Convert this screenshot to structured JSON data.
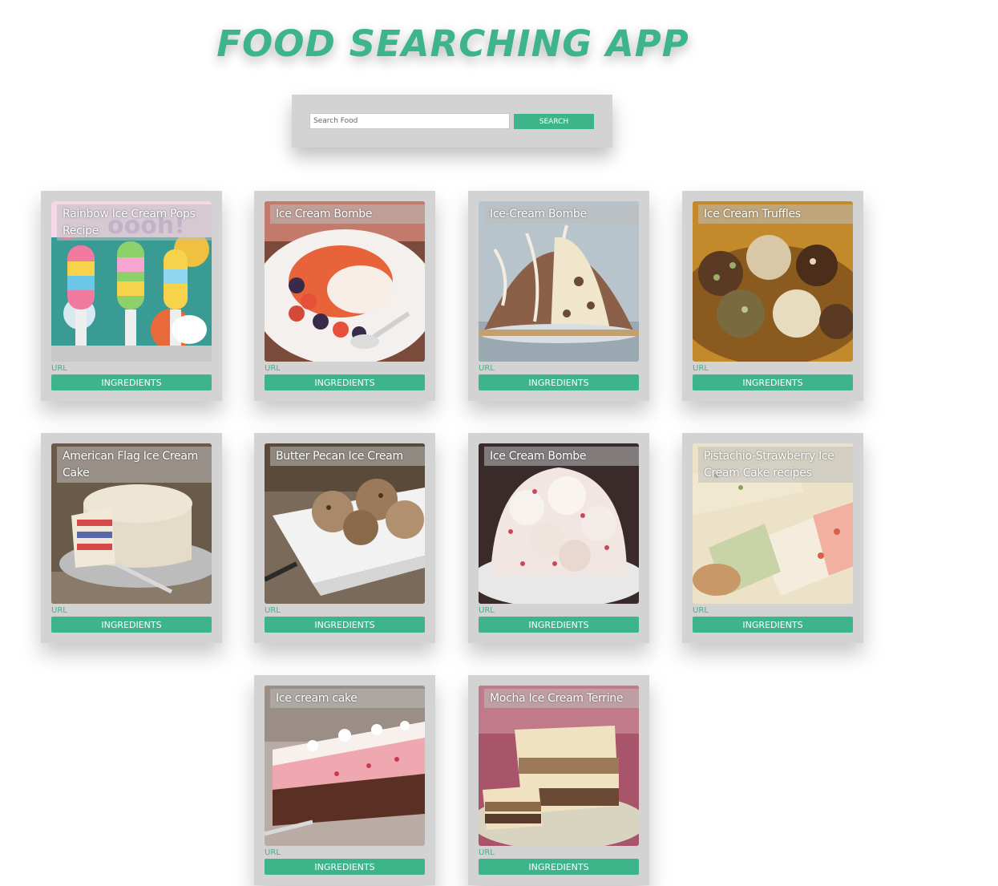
{
  "app": {
    "title": "FOOD SEARCHING APP",
    "accent_color": "#3db489"
  },
  "search": {
    "placeholder": "Search Food",
    "value": "",
    "button_label": "SEARCH"
  },
  "recipes": [
    {
      "title": "Rainbow Ice Cream Pops Recipe",
      "url_label": "URL",
      "button_label": "INGREDIENTS",
      "image": "rainbow-ice-cream-pops-photo"
    },
    {
      "title": "Ice Cream Bombe",
      "url_label": "URL",
      "button_label": "INGREDIENTS",
      "image": "ice-cream-bombe-with-berries-photo"
    },
    {
      "title": "Ice-Cream Bombe",
      "url_label": "URL",
      "button_label": "INGREDIENTS",
      "image": "chocolate-drizzled-dome-photo"
    },
    {
      "title": "Ice Cream Truffles",
      "url_label": "URL",
      "button_label": "INGREDIENTS",
      "image": "nut-coated-truffles-photo"
    },
    {
      "title": "American Flag Ice Cream Cake",
      "url_label": "URL",
      "button_label": "INGREDIENTS",
      "image": "flag-layer-cake-photo"
    },
    {
      "title": "Butter Pecan Ice Cream",
      "url_label": "URL",
      "button_label": "INGREDIENTS",
      "image": "ice-cream-scoops-bowl-photo"
    },
    {
      "title": "Ice Cream Bombe",
      "url_label": "URL",
      "button_label": "INGREDIENTS",
      "image": "peppermint-meringue-dome-photo"
    },
    {
      "title": "Pistachio-Strawberry Ice Cream Cake recipes",
      "url_label": "URL",
      "button_label": "INGREDIENTS",
      "image": "pistachio-strawberry-slices-photo"
    },
    {
      "title": "Ice cream cake",
      "url_label": "URL",
      "button_label": "INGREDIENTS",
      "image": "pink-layer-cake-slice-photo"
    },
    {
      "title": "Mocha Ice Cream Terrine",
      "url_label": "URL",
      "button_label": "INGREDIENTS",
      "image": "mocha-terrine-photo"
    }
  ]
}
